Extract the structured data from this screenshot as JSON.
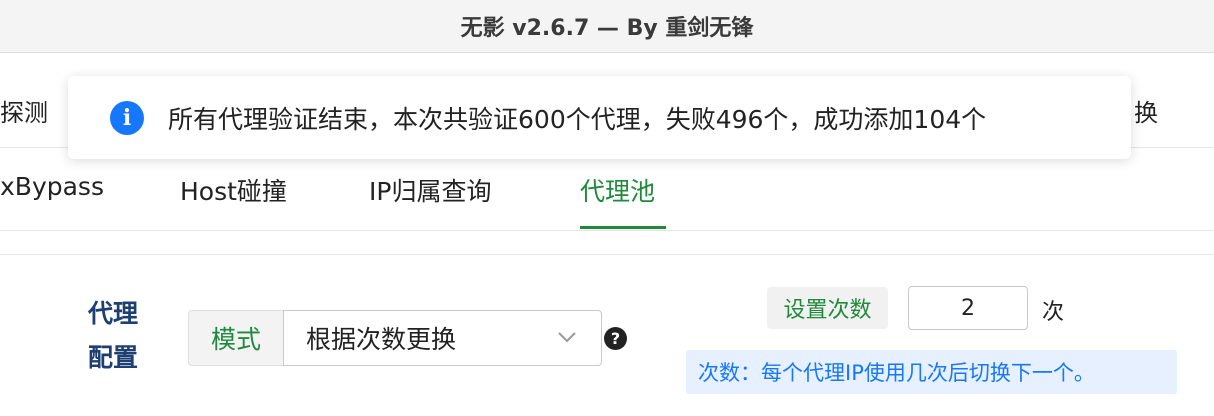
{
  "window": {
    "title": "无影 v2.6.7 — By 重剑无锋"
  },
  "tabs_row1": {
    "left_partial": "探测",
    "right_partial": "换"
  },
  "toast": {
    "icon": "info-icon",
    "message": "所有代理验证结束，本次共验证600个代理，失败496个，成功添加104个"
  },
  "tabs_row2": {
    "items": [
      {
        "label": "xBypass",
        "active": false
      },
      {
        "label": "Host碰撞",
        "active": false
      },
      {
        "label": "IP归属查询",
        "active": false
      },
      {
        "label": "代理池",
        "active": true
      }
    ]
  },
  "proxy_config": {
    "section_label_line1": "代理",
    "section_label_line2": "配置",
    "mode_label": "模式",
    "mode_value": "根据次数更换",
    "help_icon": "?",
    "set_count_label": "设置次数",
    "count_value": "2",
    "count_unit": "次",
    "hint": "次数：每个代理IP使用几次后切换下一个。"
  },
  "colors": {
    "accent_green": "#1f8a3c",
    "info_blue": "#1677ff",
    "label_navy": "#1d3f72"
  }
}
